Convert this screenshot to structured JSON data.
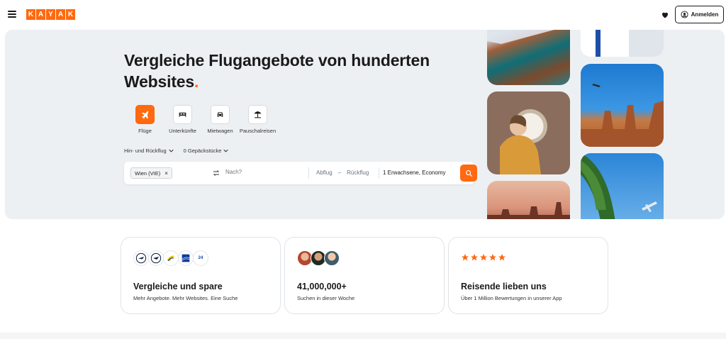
{
  "header": {
    "logo_letters": [
      "K",
      "A",
      "Y",
      "A",
      "K"
    ],
    "signin_label": "Anmelden"
  },
  "hero": {
    "title": "Vergleiche Flugangebote von hunderten Websites",
    "title_dot": "."
  },
  "verticals": [
    {
      "label": "Flüge",
      "icon": "plane-icon",
      "active": true
    },
    {
      "label": "Unterkünfte",
      "icon": "bed-icon",
      "active": false
    },
    {
      "label": "Mietwagen",
      "icon": "car-icon",
      "active": false
    },
    {
      "label": "Pauschalreisen",
      "icon": "beach-umbrella-icon",
      "active": false
    }
  ],
  "options": {
    "trip_type": "Hin- und Rückflug",
    "bags": "0 Gepäckstücke"
  },
  "search": {
    "origin_chip": "Wien (VIE)",
    "destination_placeholder": "Nach?",
    "depart": "Abflug",
    "dash": "–",
    "return": "Rückflug",
    "travelers": "1 Erwachsene, Economy"
  },
  "cards": [
    {
      "title": "Vergleiche und spare",
      "subtitle": "Mehr Angebote. Mehr Websites. Eine Suche"
    },
    {
      "title": "41,000,000+",
      "subtitle": "Suchen in dieser Woche"
    },
    {
      "title": "Reisende lieben uns",
      "subtitle": "Über 1 Million Bewertungen in unserer App"
    }
  ],
  "airline_logo_text": "24",
  "rating": {
    "stars": 5,
    "out_of": 5
  },
  "colors": {
    "brand": "#ff690f",
    "star": "#ff690f",
    "hero_bg": "#edf0f3"
  }
}
